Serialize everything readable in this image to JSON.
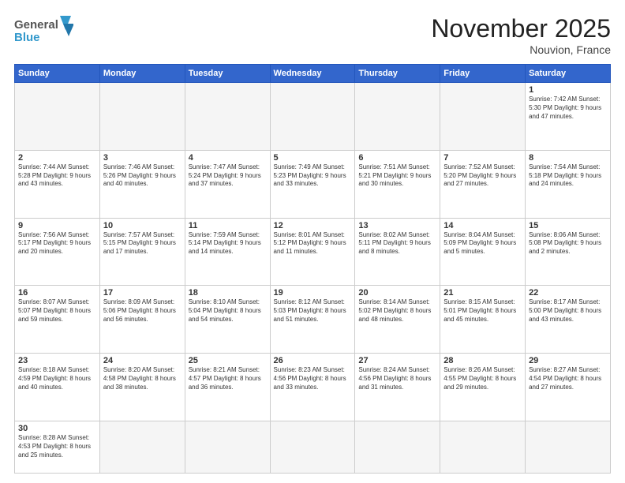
{
  "header": {
    "logo_general": "General",
    "logo_blue": "Blue",
    "month_title": "November 2025",
    "location": "Nouvion, France"
  },
  "days_of_week": [
    "Sunday",
    "Monday",
    "Tuesday",
    "Wednesday",
    "Thursday",
    "Friday",
    "Saturday"
  ],
  "weeks": [
    [
      {
        "day": "",
        "info": ""
      },
      {
        "day": "",
        "info": ""
      },
      {
        "day": "",
        "info": ""
      },
      {
        "day": "",
        "info": ""
      },
      {
        "day": "",
        "info": ""
      },
      {
        "day": "",
        "info": ""
      },
      {
        "day": "1",
        "info": "Sunrise: 7:42 AM\nSunset: 5:30 PM\nDaylight: 9 hours and 47 minutes."
      }
    ],
    [
      {
        "day": "2",
        "info": "Sunrise: 7:44 AM\nSunset: 5:28 PM\nDaylight: 9 hours and 43 minutes."
      },
      {
        "day": "3",
        "info": "Sunrise: 7:46 AM\nSunset: 5:26 PM\nDaylight: 9 hours and 40 minutes."
      },
      {
        "day": "4",
        "info": "Sunrise: 7:47 AM\nSunset: 5:24 PM\nDaylight: 9 hours and 37 minutes."
      },
      {
        "day": "5",
        "info": "Sunrise: 7:49 AM\nSunset: 5:23 PM\nDaylight: 9 hours and 33 minutes."
      },
      {
        "day": "6",
        "info": "Sunrise: 7:51 AM\nSunset: 5:21 PM\nDaylight: 9 hours and 30 minutes."
      },
      {
        "day": "7",
        "info": "Sunrise: 7:52 AM\nSunset: 5:20 PM\nDaylight: 9 hours and 27 minutes."
      },
      {
        "day": "8",
        "info": "Sunrise: 7:54 AM\nSunset: 5:18 PM\nDaylight: 9 hours and 24 minutes."
      }
    ],
    [
      {
        "day": "9",
        "info": "Sunrise: 7:56 AM\nSunset: 5:17 PM\nDaylight: 9 hours and 20 minutes."
      },
      {
        "day": "10",
        "info": "Sunrise: 7:57 AM\nSunset: 5:15 PM\nDaylight: 9 hours and 17 minutes."
      },
      {
        "day": "11",
        "info": "Sunrise: 7:59 AM\nSunset: 5:14 PM\nDaylight: 9 hours and 14 minutes."
      },
      {
        "day": "12",
        "info": "Sunrise: 8:01 AM\nSunset: 5:12 PM\nDaylight: 9 hours and 11 minutes."
      },
      {
        "day": "13",
        "info": "Sunrise: 8:02 AM\nSunset: 5:11 PM\nDaylight: 9 hours and 8 minutes."
      },
      {
        "day": "14",
        "info": "Sunrise: 8:04 AM\nSunset: 5:09 PM\nDaylight: 9 hours and 5 minutes."
      },
      {
        "day": "15",
        "info": "Sunrise: 8:06 AM\nSunset: 5:08 PM\nDaylight: 9 hours and 2 minutes."
      }
    ],
    [
      {
        "day": "16",
        "info": "Sunrise: 8:07 AM\nSunset: 5:07 PM\nDaylight: 8 hours and 59 minutes."
      },
      {
        "day": "17",
        "info": "Sunrise: 8:09 AM\nSunset: 5:06 PM\nDaylight: 8 hours and 56 minutes."
      },
      {
        "day": "18",
        "info": "Sunrise: 8:10 AM\nSunset: 5:04 PM\nDaylight: 8 hours and 54 minutes."
      },
      {
        "day": "19",
        "info": "Sunrise: 8:12 AM\nSunset: 5:03 PM\nDaylight: 8 hours and 51 minutes."
      },
      {
        "day": "20",
        "info": "Sunrise: 8:14 AM\nSunset: 5:02 PM\nDaylight: 8 hours and 48 minutes."
      },
      {
        "day": "21",
        "info": "Sunrise: 8:15 AM\nSunset: 5:01 PM\nDaylight: 8 hours and 45 minutes."
      },
      {
        "day": "22",
        "info": "Sunrise: 8:17 AM\nSunset: 5:00 PM\nDaylight: 8 hours and 43 minutes."
      }
    ],
    [
      {
        "day": "23",
        "info": "Sunrise: 8:18 AM\nSunset: 4:59 PM\nDaylight: 8 hours and 40 minutes."
      },
      {
        "day": "24",
        "info": "Sunrise: 8:20 AM\nSunset: 4:58 PM\nDaylight: 8 hours and 38 minutes."
      },
      {
        "day": "25",
        "info": "Sunrise: 8:21 AM\nSunset: 4:57 PM\nDaylight: 8 hours and 36 minutes."
      },
      {
        "day": "26",
        "info": "Sunrise: 8:23 AM\nSunset: 4:56 PM\nDaylight: 8 hours and 33 minutes."
      },
      {
        "day": "27",
        "info": "Sunrise: 8:24 AM\nSunset: 4:56 PM\nDaylight: 8 hours and 31 minutes."
      },
      {
        "day": "28",
        "info": "Sunrise: 8:26 AM\nSunset: 4:55 PM\nDaylight: 8 hours and 29 minutes."
      },
      {
        "day": "29",
        "info": "Sunrise: 8:27 AM\nSunset: 4:54 PM\nDaylight: 8 hours and 27 minutes."
      }
    ],
    [
      {
        "day": "30",
        "info": "Sunrise: 8:28 AM\nSunset: 4:53 PM\nDaylight: 8 hours and 25 minutes."
      },
      {
        "day": "",
        "info": ""
      },
      {
        "day": "",
        "info": ""
      },
      {
        "day": "",
        "info": ""
      },
      {
        "day": "",
        "info": ""
      },
      {
        "day": "",
        "info": ""
      },
      {
        "day": "",
        "info": ""
      }
    ]
  ]
}
